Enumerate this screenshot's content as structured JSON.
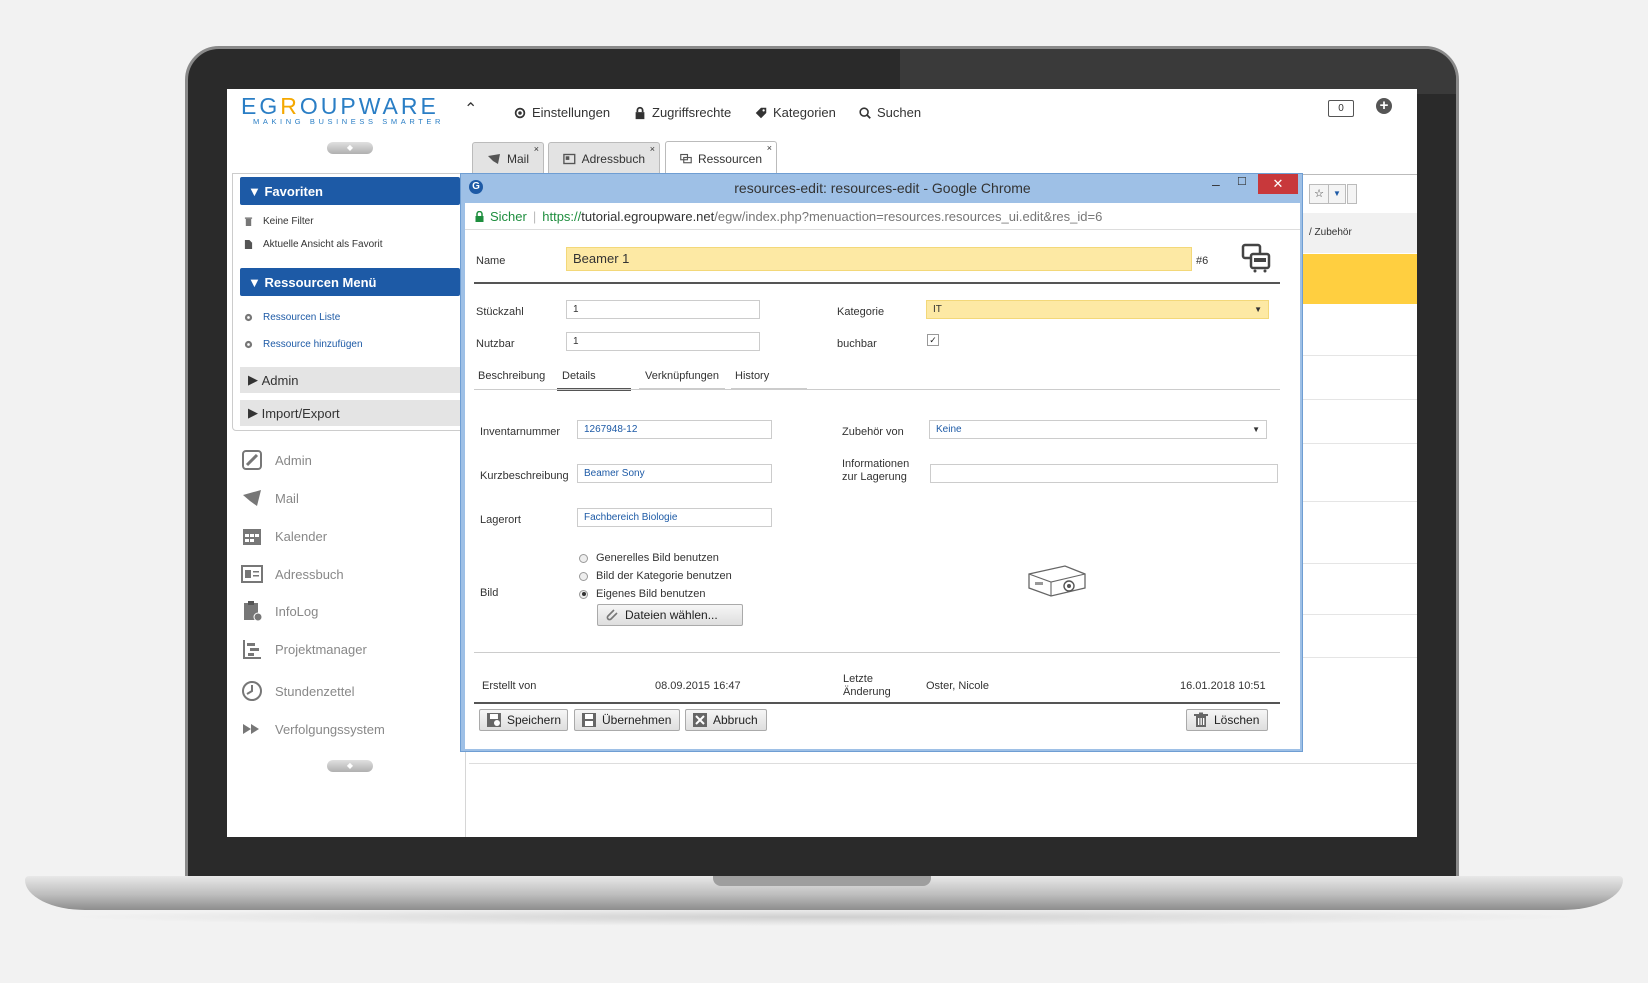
{
  "app": {
    "logo_text_pre": "EG",
    "logo_text_o": "R",
    "logo_text_post": "OUPWARE",
    "tagline": "MAKING BUSINESS SMARTER"
  },
  "topmenu": {
    "settings": "Einstellungen",
    "access": "Zugriffsrechte",
    "categories": "Kategorien",
    "search": "Suchen",
    "counter": "0"
  },
  "tabs": [
    {
      "label": "Mail"
    },
    {
      "label": "Adressbuch"
    },
    {
      "label": "Ressourcen"
    }
  ],
  "sidebar": {
    "favorites_header": "Favoriten",
    "no_filter": "Keine Filter",
    "current_view_fav": "Aktuelle Ansicht als Favorit",
    "resources_menu_header": "Ressourcen Menü",
    "resources_list": "Ressourcen Liste",
    "add_resource": "Ressource hinzufügen",
    "admin": "Admin",
    "import_export": "Import/Export",
    "apps": [
      "Admin",
      "Mail",
      "Kalender",
      "Adressbuch",
      "InfoLog",
      "Projektmanager",
      "Stundenzettel",
      "Verfolgungssystem"
    ]
  },
  "background": {
    "column_header": "/ Zubehör"
  },
  "popup": {
    "title": "resources-edit: resources-edit - Google Chrome",
    "secure": "Sicher",
    "url_scheme": "https://",
    "url_host": "tutorial.egroupware.net",
    "url_path": "/egw/index.php?menuaction=resources.resources_ui.edit&res_id=6"
  },
  "form": {
    "name_label": "Name",
    "name_value": "Beamer 1",
    "id": "#6",
    "quantity_label": "Stückzahl",
    "quantity_value": "1",
    "usable_label": "Nutzbar",
    "usable_value": "1",
    "category_label": "Kategorie",
    "category_value": "IT",
    "bookable_label": "buchbar",
    "subtabs": [
      "Beschreibung",
      "Details",
      "Verknüpfungen",
      "History"
    ],
    "inventory_label": "Inventarnummer",
    "inventory_value": "1267948-12",
    "accessory_label": "Zubehör von",
    "accessory_value": "Keine",
    "short_desc_label": "Kurzbeschreibung",
    "short_desc_value": "Beamer Sony",
    "storage_info_label_1": "Informationen",
    "storage_info_label_2": "zur Lagerung",
    "storage_info_value": "",
    "location_label": "Lagerort",
    "location_value": "Fachbereich Biologie",
    "image_label": "Bild",
    "radio_general": "Generelles Bild benutzen",
    "radio_category": "Bild der Kategorie benutzen",
    "radio_own": "Eigenes Bild benutzen",
    "choose_files": "Dateien wählen...",
    "created_by_label": "Erstellt von",
    "created_date": "08.09.2015 16:47",
    "last_change_label_1": "Letzte",
    "last_change_label_2": "Änderung",
    "last_change_user": "Oster, Nicole",
    "last_change_date": "16.01.2018 10:51",
    "btn_save": "Speichern",
    "btn_apply": "Übernehmen",
    "btn_cancel": "Abbruch",
    "btn_delete": "Löschen"
  },
  "colors": {
    "accent_blue": "#1d5aa6",
    "logo_orange": "#f5a800",
    "highlight_yellow": "#fde9a4"
  }
}
